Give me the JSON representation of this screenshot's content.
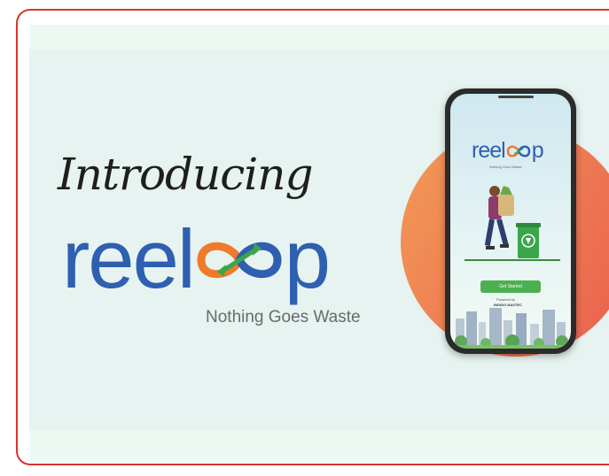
{
  "banner": {
    "intro_text": "Introducing",
    "logo_text_left": "reel",
    "logo_text_right": "p",
    "tagline": "Nothing Goes Waste"
  },
  "phone": {
    "logo_text_left": "reel",
    "logo_text_right": "p",
    "tagline": "Nothing Goes Waste",
    "button_label": "Get Started",
    "powered_label": "Powered by",
    "powered_name": "INDIGO NAXTEC"
  },
  "colors": {
    "brand_blue": "#2f5fb0",
    "loop_orange": "#f07a2a",
    "loop_green": "#3aa64a",
    "circle_orange": "#ee7b50",
    "button_green": "#4caf50",
    "frame_red": "#d9342c"
  },
  "icons": {
    "logo_loop": "infinity-loop-arrows-icon",
    "phone_loop": "infinity-loop-icon",
    "recycle_bin": "recycle-bin-icon",
    "person": "person-carrying-bag-illustration",
    "city": "city-skyline-illustration"
  }
}
